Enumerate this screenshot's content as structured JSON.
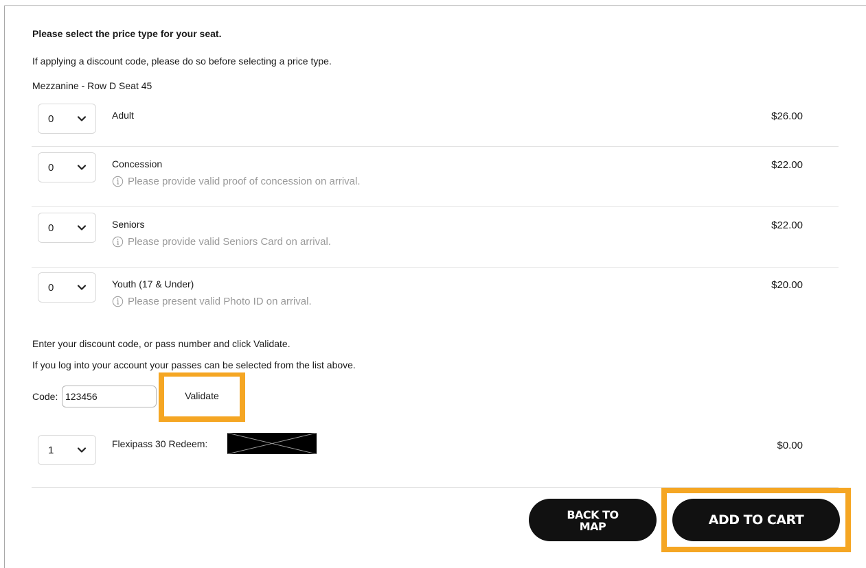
{
  "intro": {
    "heading": "Please select the price type for your seat.",
    "discount_notice": "If applying a discount code, please do so before selecting a price type.",
    "seat": "Mezzanine - Row D Seat 45"
  },
  "price_types": [
    {
      "qty": "0",
      "name": "Adult",
      "note": "",
      "price": "$26.00"
    },
    {
      "qty": "0",
      "name": "Concession",
      "note": "Please provide valid proof of concession on arrival.",
      "price": "$22.00"
    },
    {
      "qty": "0",
      "name": "Seniors",
      "note": "Please provide valid Seniors Card on arrival.",
      "price": "$22.00"
    },
    {
      "qty": "0",
      "name": "Youth (17 & Under)",
      "note": "Please present valid Photo ID on arrival.",
      "price": "$20.00"
    }
  ],
  "discount": {
    "instruction": "Enter your discount code, or pass number and click Validate.",
    "login_hint": "If you log into your account your passes can be selected from the list above.",
    "code_label": "Code:",
    "code_value": "123456",
    "validate_label": "Validate"
  },
  "pass_item": {
    "qty": "1",
    "name": "Flexipass 30 Redeem:",
    "price": "$0.00"
  },
  "buttons": {
    "back_to_map": "BACK TO\nMAP",
    "add_to_cart": "ADD TO CART"
  },
  "colors": {
    "highlight": "#f5a623",
    "button_bg": "#111111",
    "note_text": "#9a9a9a"
  }
}
